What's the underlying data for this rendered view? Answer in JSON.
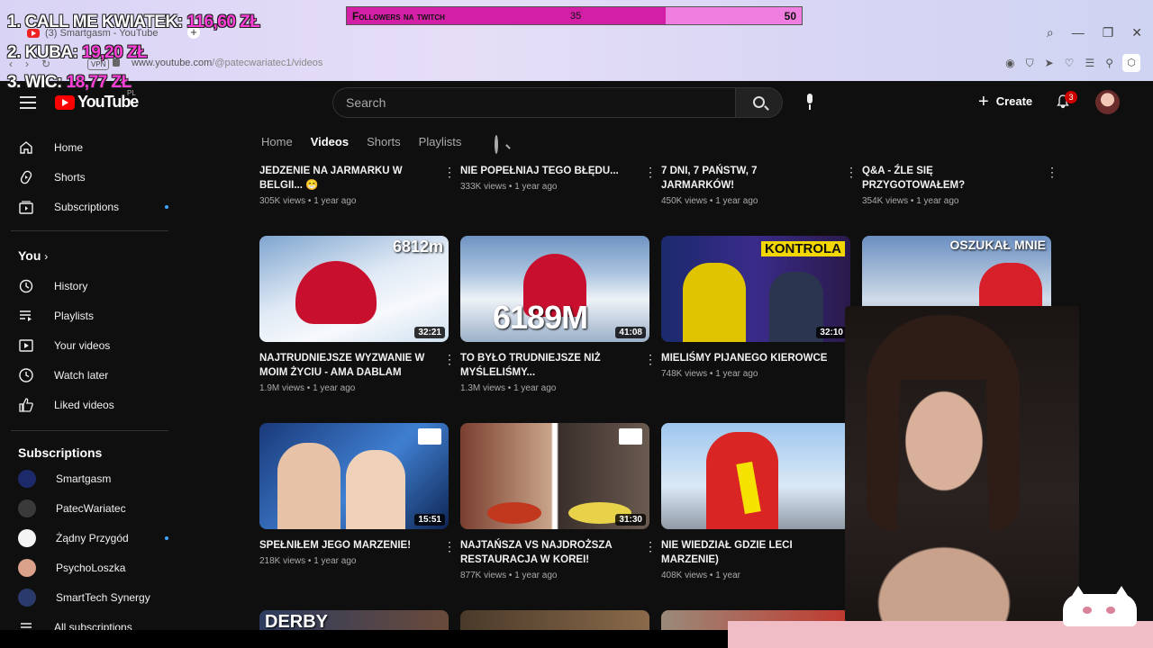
{
  "browser": {
    "tab_title": "(3) Smartgasm - YouTube",
    "vpn_label": "VPN",
    "url_host": "www.youtube.com",
    "url_path": "/@patecwariatec1/videos",
    "new_tab_label": "+"
  },
  "overlay": {
    "donors": [
      {
        "rank_name": "1. CALL ME KWIATEK:",
        "amount": "116,60 ZŁ"
      },
      {
        "rank_name": "2. KUBA:",
        "amount": "19,20 ZŁ"
      },
      {
        "rank_name": "3. WIC:",
        "amount": "18,77 ZŁ"
      }
    ],
    "followers": {
      "label": "Followers na twitch",
      "current": "35",
      "goal": "50",
      "progress": 0.7
    }
  },
  "masthead": {
    "logo_text": "YouTube",
    "country_code": "PL",
    "search_placeholder": "Search",
    "create_label": "Create",
    "notification_count": "3"
  },
  "sidebar": {
    "main": [
      {
        "label": "Home",
        "icon": "home-icon"
      },
      {
        "label": "Shorts",
        "icon": "shorts-icon"
      },
      {
        "label": "Subscriptions",
        "icon": "subscriptions-icon"
      }
    ],
    "you_heading": "You",
    "you_items": [
      {
        "label": "History",
        "icon": "history-icon"
      },
      {
        "label": "Playlists",
        "icon": "playlists-icon"
      },
      {
        "label": "Your videos",
        "icon": "your-videos-icon"
      },
      {
        "label": "Watch later",
        "icon": "watch-later-icon"
      },
      {
        "label": "Liked videos",
        "icon": "liked-icon"
      }
    ],
    "subs_heading": "Subscriptions",
    "subs": [
      {
        "label": "Smartgasm",
        "color": "#1c2a6b"
      },
      {
        "label": "PatecWariatec",
        "color": "#3a3a3a"
      },
      {
        "label": "Żądny Przygód",
        "color": "#f4f4f4"
      },
      {
        "label": "PsychoLoszka",
        "color": "#d9a08a"
      },
      {
        "label": "SmartTech Synergy",
        "color": "#2a3a6b"
      }
    ],
    "all_subs_label": "All subscriptions"
  },
  "channel_tabs": [
    "Home",
    "Videos",
    "Shorts",
    "Playlists"
  ],
  "videos_row0": [
    {
      "title": "JEDZENIE NA JARMARKU W BELGII... 😁",
      "meta": "305K views • 1 year ago"
    },
    {
      "title": "NIE POPEŁNIAJ TEGO BŁĘDU...",
      "meta": "333K views • 1 year ago"
    },
    {
      "title": "7 DNI, 7 PAŃSTW, 7 JARMARKÓW!",
      "meta": "450K views • 1 year ago"
    },
    {
      "title": "Q&A - ŹLE SIĘ PRZYGOTOWAŁEM?",
      "meta": "354K views • 1 year ago"
    }
  ],
  "videos_row1": [
    {
      "title": "NAJTRUDNIEJSZE WYZWANIE W MOIM ŻYCIU - AMA DABLAM",
      "meta": "1.9M views • 1 year ago",
      "duration": "32:21",
      "overlay": "6812m"
    },
    {
      "title": "TO BYŁO TRUDNIEJSZE NIŻ MYŚLELIŚMY...",
      "meta": "1.3M views • 1 year ago",
      "duration": "41:08",
      "overlay": "6189M"
    },
    {
      "title": "MIELIŚMY PIJANEGO KIEROWCE",
      "meta": "748K views • 1 year ago",
      "duration": "32:10",
      "overlay": "KONTROLA"
    },
    {
      "title": "",
      "meta": "",
      "duration": "",
      "overlay": "OSZUKAŁ MNIE"
    }
  ],
  "videos_row2": [
    {
      "title": "SPEŁNIŁEM JEGO MARZENIE!",
      "meta": "218K views • 1 year ago",
      "duration": "15:51"
    },
    {
      "title": "NAJTAŃSZA vs NAJDROŻSZA RESTAURACJA w KOREI!",
      "meta": "877K views • 1 year ago",
      "duration": "31:30"
    },
    {
      "title": "NIE WIEDZIAŁ GDZIE LECI MARZENIE)",
      "meta": "408K views • 1 year",
      "duration": ""
    }
  ],
  "row3_overlay": "DERBY"
}
